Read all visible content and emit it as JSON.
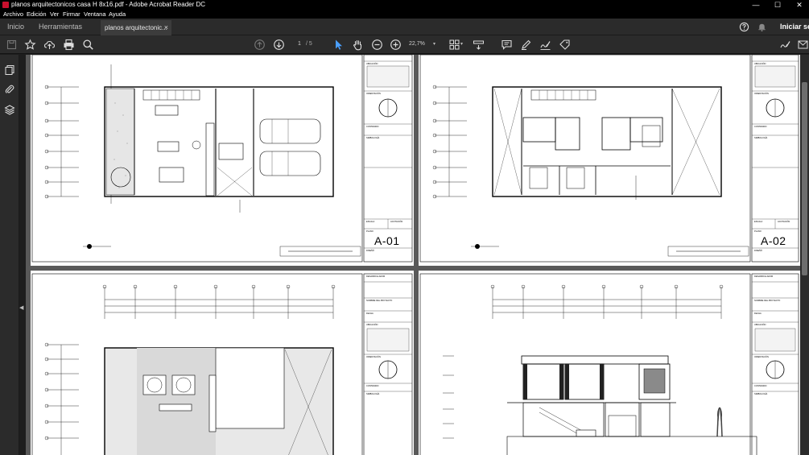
{
  "window": {
    "title": "planos arquitectonicos casa H 8x16.pdf - Adobe Acrobat Reader DC",
    "minimize": "—",
    "maximize": "☐",
    "close": "✕"
  },
  "menu": [
    "Archivo",
    "Edición",
    "Ver",
    "Firmar",
    "Ventana",
    "Ayuda"
  ],
  "tabs": {
    "home": "Inicio",
    "tools": "Herramientas",
    "document": "planos arquitectonic...",
    "document_close": "×",
    "signin": "Iniciar se"
  },
  "toolbar": {
    "page_current": "1",
    "page_total": "/  5",
    "zoom": "22,7%",
    "dropdown_caret": "▾"
  },
  "pages": [
    {
      "sheet_code": "A-01",
      "labels": {
        "ubicacion": "UBICACIÓN",
        "orientacion": "ORIENTACIÓN",
        "contenido": "CONTENIDO",
        "simbologia": "SIMBOLOGÍA",
        "escala": "ESCALA",
        "acotacion": "ACOTACIÓN",
        "plano": "PLANO",
        "diseño": "DISEÑÓ"
      }
    },
    {
      "sheet_code": "A-02",
      "labels": {
        "ubicacion": "UBICACIÓN",
        "orientacion": "ORIENTACIÓN",
        "contenido": "CONTENIDO",
        "simbologia": "SIMBOLOGÍA",
        "escala": "ESCALA",
        "acotacion": "ACOTACIÓN",
        "plano": "PLANO",
        "diseño": "DISEÑÓ"
      }
    },
    {
      "labels": {
        "desarrollador": "DESARROLLADOR",
        "proyecto": "NOMBRE DEL PROYECTO",
        "fecha": "FECHA",
        "ubicacion": "UBICACIÓN",
        "orientacion": "ORIENTACIÓN",
        "contenido": "CONTENIDO",
        "simbologia": "SIMBOLOGÍA"
      }
    },
    {
      "labels": {
        "desarrollador": "DESARROLLADOR",
        "proyecto": "NOMBRE DEL PROYECTO",
        "fecha": "FECHA",
        "ubicacion": "UBICACIÓN",
        "orientacion": "ORIENTACIÓN",
        "contenido": "CONTENIDO",
        "simbologia": "SIMBOLOGÍA"
      }
    }
  ]
}
